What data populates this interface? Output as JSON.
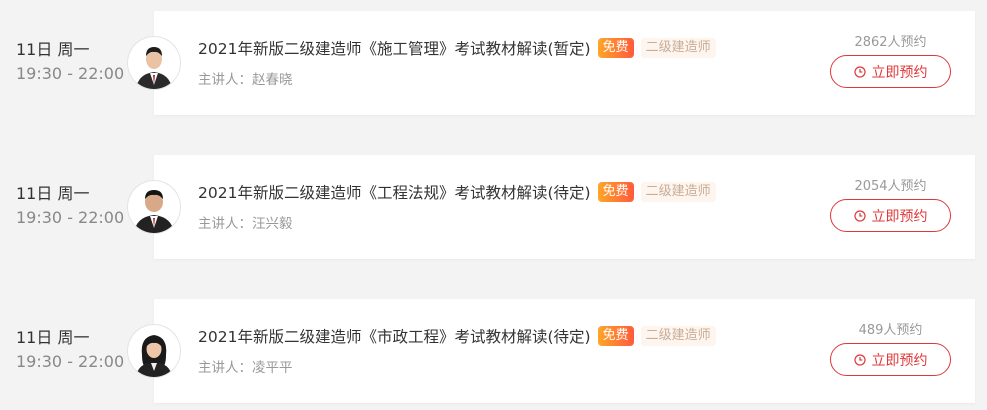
{
  "sessions": [
    {
      "date": "11日 周一",
      "hours": "19:30 - 22:00",
      "title": "2021年新版二级建造师《施工管理》考试教材解读(暂定)",
      "free_badge": "免费",
      "category_badge": "二级建造师",
      "lecturer": "主讲人：赵春晓",
      "count": "2862人预约",
      "button": "立即预约"
    },
    {
      "date": "11日 周一",
      "hours": "19:30 - 22:00",
      "title": "2021年新版二级建造师《工程法规》考试教材解读(待定)",
      "free_badge": "免费",
      "category_badge": "二级建造师",
      "lecturer": "主讲人：汪兴毅",
      "count": "2054人预约",
      "button": "立即预约"
    },
    {
      "date": "11日 周一",
      "hours": "19:30 - 22:00",
      "title": "2021年新版二级建造师《市政工程》考试教材解读(待定)",
      "free_badge": "免费",
      "category_badge": "二级建造师",
      "lecturer": "主讲人：凌平平",
      "count": "489人预约",
      "button": "立即预约"
    }
  ],
  "colors": {
    "accent": "#e0383a",
    "free_badge_from": "#ffa526",
    "free_badge_to": "#ff5a3d",
    "category_text": "#c9ad96",
    "category_bg": "#fdf5ee"
  }
}
